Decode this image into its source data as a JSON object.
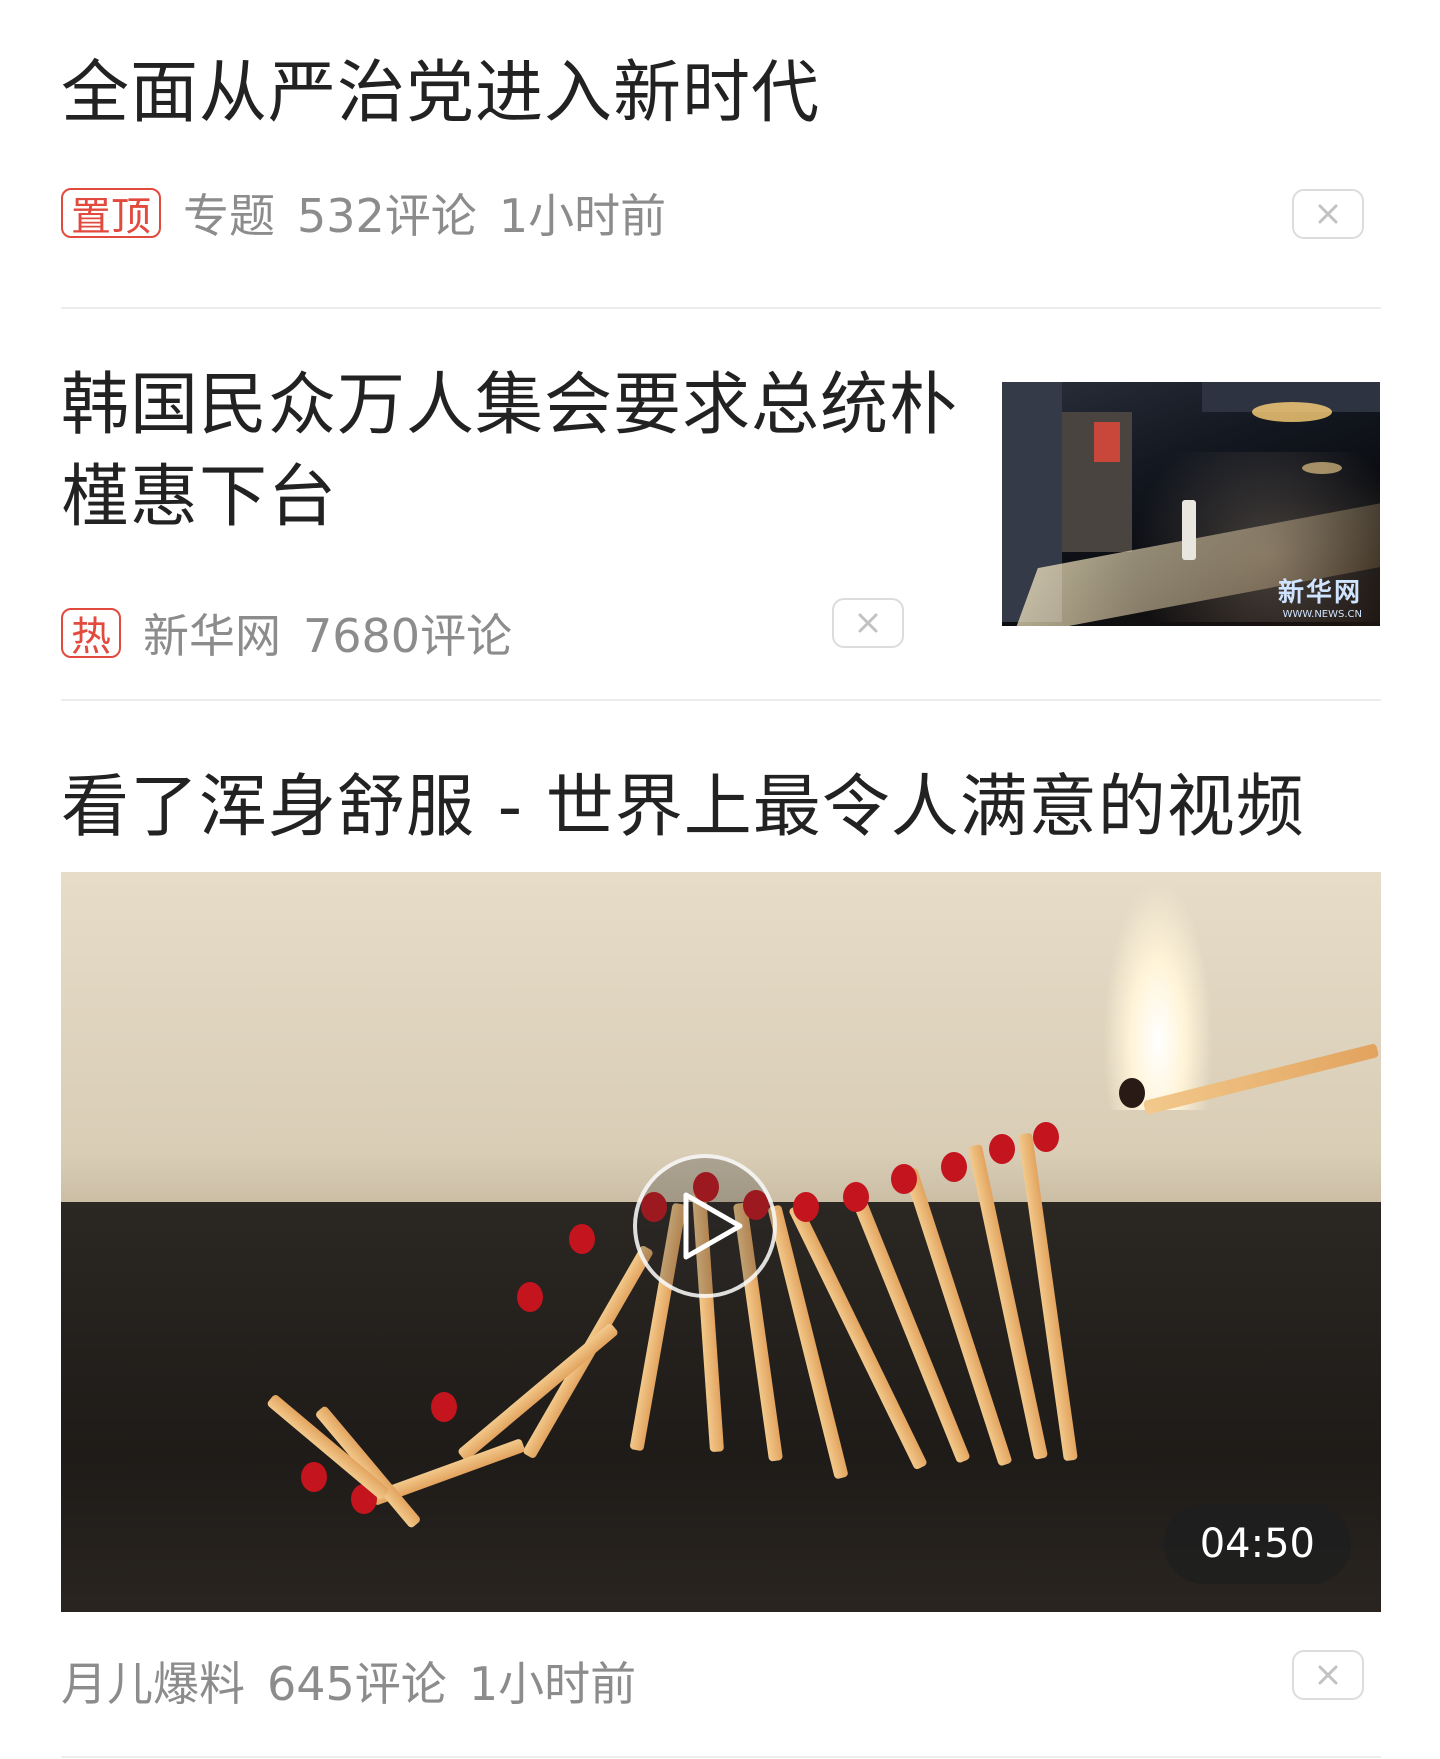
{
  "feed": {
    "items": [
      {
        "title": "全面从严治党进入新时代",
        "tag": "置顶",
        "source": "专题",
        "comments": "532评论",
        "time": "1小时前"
      },
      {
        "title_line1": "韩国民众万人集会要求总统朴",
        "title_line2": "槿惠下台",
        "tag": "热",
        "source": "新华网",
        "comments": "7680评论",
        "thumb_watermark": "新华网",
        "thumb_watermark_url": "WWW.NEWS.CN"
      },
      {
        "title": "看了浑身舒服 - 世界上最令人满意的视频",
        "source": "月儿爆料",
        "comments": "645评论",
        "time": "1小时前",
        "duration": "04:50"
      }
    ]
  },
  "colors": {
    "accent_tag": "#e24a3e",
    "meta_text": "#8c8c8c",
    "title_text": "#222222",
    "divider": "#ececec"
  },
  "icons": {
    "close": "close-icon",
    "play": "play-icon"
  }
}
